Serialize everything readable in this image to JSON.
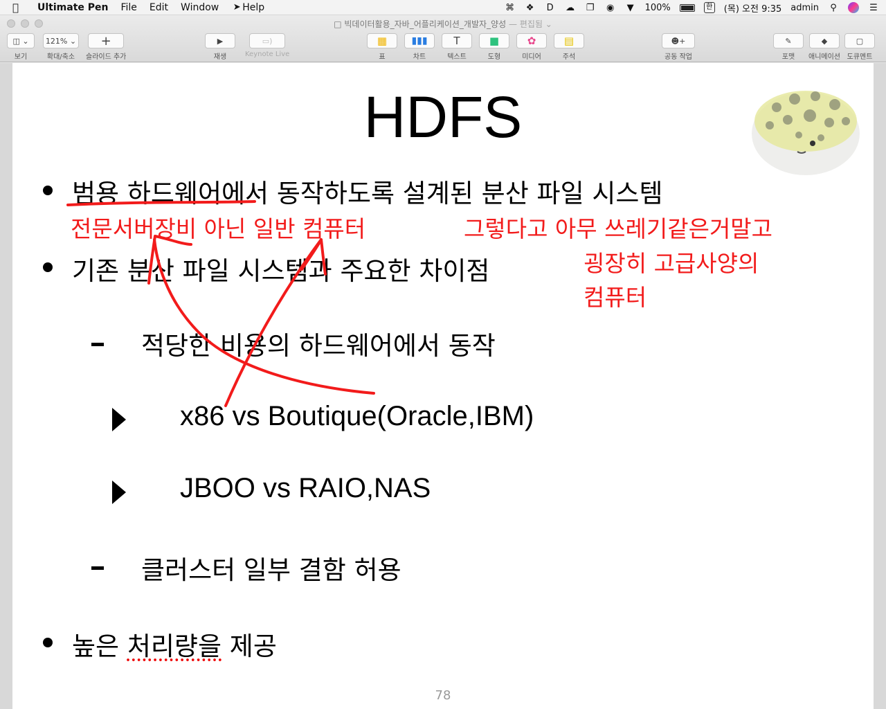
{
  "menubar": {
    "app_name": "Ultimate Pen",
    "items": [
      "File",
      "Edit",
      "Window",
      "Help"
    ],
    "battery": "100%",
    "ime": "한",
    "clock": "(목) 오전 9:35",
    "user": "admin"
  },
  "window": {
    "doc_title": "빅데이터활용_자바_어플리케이션_개발자_양성",
    "edited": "— 편집됨"
  },
  "toolbar": {
    "view": "보기",
    "zoom_value": "121%",
    "zoom": "확대/축소",
    "add_slide": "슬라이드 추가",
    "play": "재생",
    "keynote_live": "Keynote Live",
    "table": "표",
    "chart": "차트",
    "text": "텍스트",
    "shape": "도형",
    "media": "미디어",
    "comment": "주석",
    "collaborate": "공동 작업",
    "format": "포맷",
    "animate": "애니메이션",
    "document": "도큐멘트"
  },
  "slide": {
    "title": "HDFS",
    "bullets": {
      "b1": "범용 하드웨어에서 동작하도록 설계된 분산 파일 시스템",
      "b2": "기존 분산 파일 시스템과 주요한 차이점",
      "b3": "적당한 비용의 하드웨어에서 동작",
      "b4": "x86 vs Boutique(Oracle,IBM)",
      "b5": "JBOO vs RAIO,NAS",
      "b6": "클러스터 일부 결함 허용",
      "b7_a": "높은 ",
      "b7_b": "처리량을",
      "b7_c": " 제공"
    },
    "annotations": {
      "n1": "전문서버장비 아닌 일반 컴퓨터",
      "n2": "그렇다고 아무 쓰레기같은거말고",
      "n3": "굉장히 고급사양의",
      "n4": "컴퓨터"
    },
    "page_number": "78",
    "annotation_color": "#f21b1b"
  }
}
